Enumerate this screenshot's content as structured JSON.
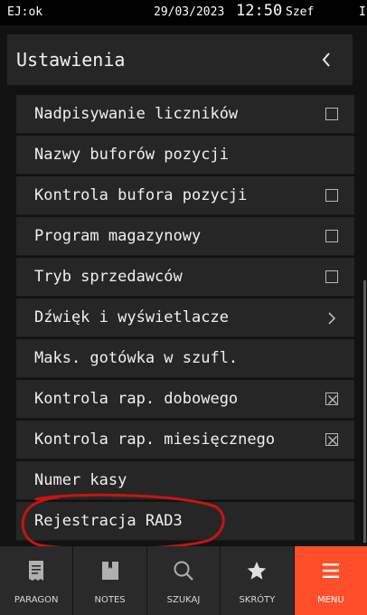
{
  "statusbar": {
    "left": "EJ:ok",
    "date": "29/03/2023",
    "time": "12:50",
    "user": "Szef",
    "right": "I"
  },
  "header": {
    "title": "Ustawienia",
    "back_icon": "chevron-left-icon"
  },
  "settings": {
    "items": [
      {
        "label": "Nadpisywanie liczników",
        "control": "checkbox",
        "checked": false
      },
      {
        "label": "Nazwy buforów pozycji",
        "control": "none"
      },
      {
        "label": "Kontrola bufora pozycji",
        "control": "checkbox",
        "checked": false
      },
      {
        "label": "Program magazynowy",
        "control": "checkbox",
        "checked": false
      },
      {
        "label": "Tryb sprzedawców",
        "control": "checkbox",
        "checked": false
      },
      {
        "label": "Dźwięk i wyświetlacze",
        "control": "chevron"
      },
      {
        "label": "Maks. gotówka w szufl.",
        "control": "none"
      },
      {
        "label": "Kontrola rap. dobowego",
        "control": "checkbox",
        "checked": true
      },
      {
        "label": "Kontrola rap. miesięcznego",
        "control": "checkbox",
        "checked": true
      },
      {
        "label": "Numer kasy",
        "control": "none"
      },
      {
        "label": "Rejestracja RAD3",
        "control": "none",
        "annotated": true
      }
    ]
  },
  "annotation": {
    "color": "#c81414"
  },
  "tabbar": {
    "active_color": "#ff4e2a",
    "tabs": [
      {
        "label": "PARAGON",
        "icon": "receipt-icon"
      },
      {
        "label": "NOTES",
        "icon": "notebook-icon"
      },
      {
        "label": "SZUKAJ",
        "icon": "search-icon"
      },
      {
        "label": "SKRÓTY",
        "icon": "star-icon"
      },
      {
        "label": "MENU",
        "icon": "menu-icon",
        "active": true
      }
    ]
  }
}
